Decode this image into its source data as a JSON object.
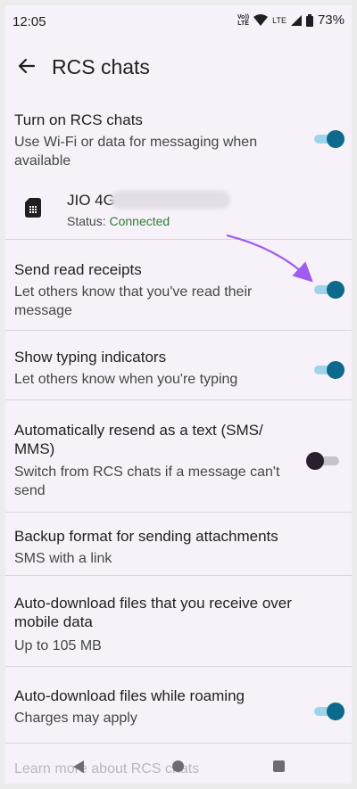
{
  "status_bar": {
    "time": "12:05",
    "volte_top": "Vo))",
    "volte_bottom": "LTE",
    "network_type": "LTE",
    "battery": "73%"
  },
  "app_bar": {
    "title": "RCS chats",
    "back_icon": "arrow-back-icon"
  },
  "settings": [
    {
      "id": "rcs",
      "title": "Turn on RCS chats",
      "subtitle": "Use Wi-Fi or data for messaging when available",
      "enabled": true
    },
    {
      "id": "read_receipts",
      "title": "Send read receipts",
      "subtitle": "Let others know that you've read their message",
      "enabled": true
    },
    {
      "id": "typing",
      "title": "Show typing indicators",
      "subtitle": "Let others know when you're typing",
      "enabled": true
    },
    {
      "id": "resend",
      "title": "Automatically resend as a text (SMS/ MMS)",
      "subtitle": "Switch from RCS chats if a message can't send",
      "enabled": false
    },
    {
      "id": "backup",
      "title": "Backup format for sending attachments",
      "subtitle": "SMS with a link"
    },
    {
      "id": "autodl_mobile",
      "title": "Auto-download files that you receive over mobile data",
      "subtitle": "Up to 105 MB"
    },
    {
      "id": "autodl_roaming",
      "title": "Auto-download files while roaming",
      "subtitle": "Charges may apply",
      "enabled": true
    }
  ],
  "sim": {
    "name": "JIO 4G",
    "status_label": "Status: ",
    "status_value": "Connected",
    "icon": "sim-card-icon"
  },
  "footer_link": "Learn more about RCS chats",
  "nav_bar": {
    "back": "nav-back-icon",
    "home": "nav-home-icon",
    "recents": "nav-recents-icon"
  },
  "colors": {
    "background": "#f7f2fa",
    "switch_on_thumb": "#0e6a8c",
    "switch_on_track": "#9fd3ea",
    "switch_off_thumb": "#2a1f2d",
    "status_connected": "#2e7d32",
    "annotation_arrow": "#a05cf0"
  }
}
